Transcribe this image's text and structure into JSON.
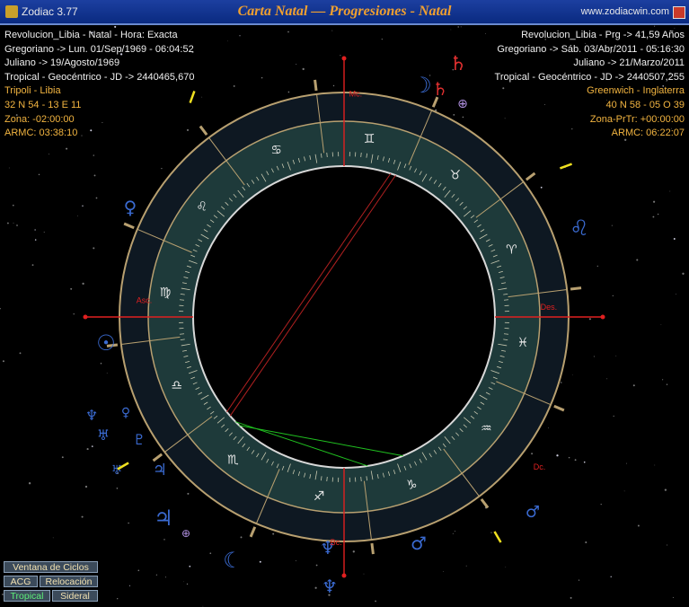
{
  "window": {
    "app_title": "Zodiac 3.77",
    "chart_title": "Carta Natal — Progresiones - Natal",
    "website": "www.zodiacwin.com"
  },
  "natal_info": [
    "Revolucion_Libia - Natal - Hora: Exacta",
    "Gregoriano -> Lun. 01/Sep/1969 - 06:04:52",
    "Juliano -> 19/Agosto/1969",
    "Tropical - Geocéntrico - JD -> 2440465,670",
    "Tripoli - Libia",
    "32 N 54 - 13 E 11",
    "Zona: -02:00:00",
    "ARMC: 03:38:10"
  ],
  "progression_info": [
    "Revolucion_Libia - Prg -> 41,59 Años",
    "Gregoriano -> Sáb. 03/Abr/2011 - 05:16:30",
    "Juliano -> 21/Marzo/2011",
    "Tropical - Geocéntrico - JD -> 2440507,255",
    "Greenwich - Inglaterra",
    "40 N 58 - 05 O 39",
    "Zona-PrTr: +00:00:00",
    "ARMC: 06:22:07"
  ],
  "chart": {
    "angles": {
      "asc": "Asc.",
      "des": "Des.",
      "mc": "Mc.",
      "bc": "Bc."
    },
    "signs": [
      {
        "glyph": "♈",
        "name": "aries"
      },
      {
        "glyph": "♉",
        "name": "taurus"
      },
      {
        "glyph": "♊",
        "name": "gemini"
      },
      {
        "glyph": "♋",
        "name": "cancer"
      },
      {
        "glyph": "♌",
        "name": "leo"
      },
      {
        "glyph": "♍",
        "name": "virgo"
      },
      {
        "glyph": "♎",
        "name": "libra"
      },
      {
        "glyph": "♏",
        "name": "scorpio"
      },
      {
        "glyph": "♐",
        "name": "sagittarius"
      },
      {
        "glyph": "♑",
        "name": "capricorn"
      },
      {
        "glyph": "♒",
        "name": "aquarius"
      },
      {
        "glyph": "♓",
        "name": "pisces"
      }
    ],
    "outer_glyphs": [
      {
        "glyph": "♄",
        "name": "saturn",
        "color": "#e03030"
      },
      {
        "glyph": "☽",
        "name": "moon",
        "color": "#3a6ad0"
      },
      {
        "glyph": "♄",
        "name": "saturn-secondary",
        "color": "#e03030"
      },
      {
        "glyph": "⊕",
        "name": "part-of-fortune",
        "color": "#b090e0"
      },
      {
        "glyph": "♌",
        "name": "leo-outer",
        "color": "#3a6ad0"
      },
      {
        "glyph": "♀",
        "name": "venus",
        "color": "#3a6ad0"
      },
      {
        "glyph": "☉",
        "name": "sun",
        "color": "#3a6ad0"
      },
      {
        "glyph": "♆",
        "name": "neptune-left",
        "color": "#3a6ad0"
      },
      {
        "glyph": "♀",
        "name": "venus-small",
        "color": "#3a6ad0"
      },
      {
        "glyph": "♅",
        "name": "uranus",
        "color": "#3a6ad0"
      },
      {
        "glyph": "♇",
        "name": "pluto",
        "color": "#3a6ad0"
      },
      {
        "glyph": "♅",
        "name": "uranus-secondary",
        "color": "#3a6ad0"
      },
      {
        "glyph": "♃",
        "name": "jupiter",
        "color": "#3a6ad0"
      },
      {
        "glyph": "♃",
        "name": "jupiter-lower",
        "color": "#3a6ad0"
      },
      {
        "glyph": "⊕",
        "name": "part-of-fortune-lower",
        "color": "#b090e0"
      },
      {
        "glyph": "☾",
        "name": "moon-lower",
        "color": "#3a6ad0"
      },
      {
        "glyph": "♆",
        "name": "neptune-bottom",
        "color": "#3a6ad0"
      },
      {
        "glyph": "♆",
        "name": "neptune-inner",
        "color": "#3a6ad0"
      },
      {
        "glyph": "♂",
        "name": "mars",
        "color": "#3a6ad0"
      },
      {
        "glyph": "♂",
        "name": "mars-right",
        "color": "#3a6ad0"
      }
    ]
  },
  "buttons": {
    "cycles": "Ventana de Ciclos",
    "acg": "ACG",
    "relocation": "Relocación",
    "tropical": "Tropical",
    "sidereal": "Sideral"
  },
  "colors": {
    "title_text": "#f0a030",
    "info_orange": "#f2b440",
    "wheel_ring": "#0e1822",
    "zodiac_band": "#1e3a3a",
    "glyph_blue": "#3a6ad0",
    "angle_red": "#e02020",
    "active_button": "#5ef07a"
  }
}
